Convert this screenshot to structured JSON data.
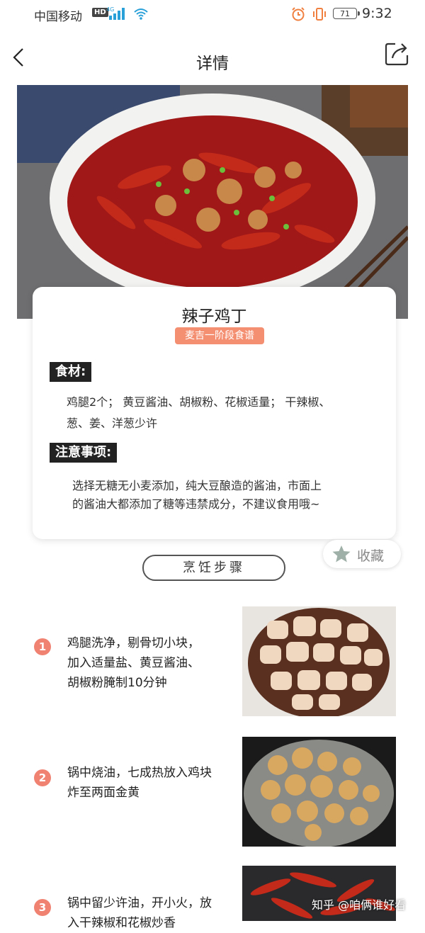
{
  "status_bar": {
    "carrier": "中国移动",
    "hd": "HD",
    "battery": "71",
    "time": "9:32"
  },
  "nav": {
    "title": "详情"
  },
  "recipe": {
    "name": "辣子鸡丁",
    "tag": "麦吉一阶段食谱",
    "ingredients_heading": "食材:",
    "ingredients_lines": [
      "鸡腿2个； 黄豆酱油、胡椒粉、花椒适量； 干辣椒、",
      "葱、姜、洋葱少许"
    ],
    "notes_heading": "注意事项:",
    "notes_lines": [
      "选择无糖无小麦添加，纯大豆酿造的酱油，市面上",
      "的酱油大都添加了糖等违禁成分，不建议食用哦~"
    ]
  },
  "favorite": {
    "label": "收藏"
  },
  "steps_button": "烹饪步骤",
  "steps": [
    {
      "num": "1",
      "lines": [
        "鸡腿洗净，剔骨切小块，",
        "加入适量盐、黄豆酱油、",
        "胡椒粉腌制10分钟"
      ]
    },
    {
      "num": "2",
      "lines": [
        "锅中烧油，七成热放入鸡块",
        "炸至两面金黄"
      ]
    },
    {
      "num": "3",
      "lines": [
        "锅中留少许油，开小火，放",
        "入干辣椒和花椒炒香"
      ]
    }
  ],
  "watermark": "知乎 @咱俩谁好看",
  "colors": {
    "accent": "#f48f72",
    "step_badge": "#f08272",
    "heading_bg": "#222222"
  }
}
